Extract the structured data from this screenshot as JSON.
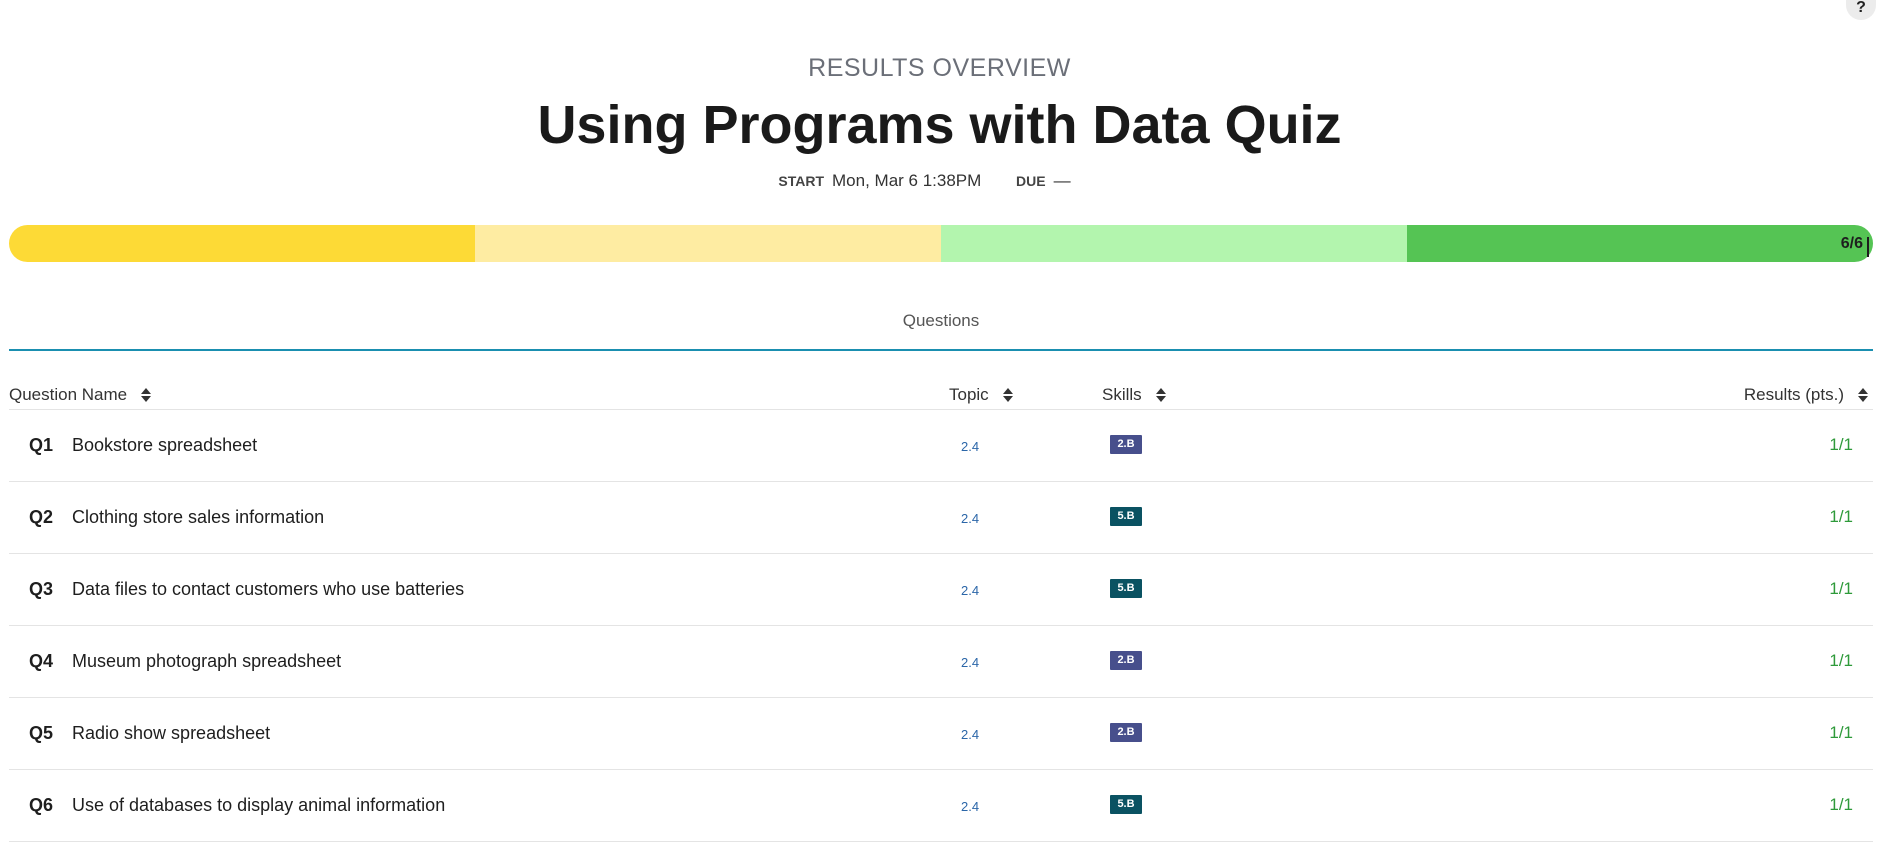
{
  "help": {
    "label": "?"
  },
  "header": {
    "overline": "RESULTS OVERVIEW",
    "title": "Using Programs with Data Quiz",
    "start_label": "START",
    "start_value": "Mon, Mar 6 1:38PM",
    "due_label": "DUE",
    "due_value": "—"
  },
  "progress": {
    "label": "6/6",
    "segments": [
      {
        "color": "#fdda36"
      },
      {
        "color": "#feeca2"
      },
      {
        "color": "#b3f5ae"
      },
      {
        "color": "#55c454"
      }
    ]
  },
  "tabs": [
    {
      "label": "Questions"
    }
  ],
  "table": {
    "columns": {
      "name": "Question Name",
      "topic": "Topic",
      "skills": "Skills",
      "results": "Results (pts.)"
    },
    "skill_colors": {
      "2.B": "#474f8c",
      "5.B": "#0a5262"
    },
    "rows": [
      {
        "num": "Q1",
        "name": "Bookstore spreadsheet",
        "topic": "2.4",
        "skill": "2.B",
        "score": "1/1"
      },
      {
        "num": "Q2",
        "name": "Clothing store sales information",
        "topic": "2.4",
        "skill": "5.B",
        "score": "1/1"
      },
      {
        "num": "Q3",
        "name": "Data files to contact customers who use batteries",
        "topic": "2.4",
        "skill": "5.B",
        "score": "1/1"
      },
      {
        "num": "Q4",
        "name": "Museum photograph spreadsheet",
        "topic": "2.4",
        "skill": "2.B",
        "score": "1/1"
      },
      {
        "num": "Q5",
        "name": "Radio show spreadsheet",
        "topic": "2.4",
        "skill": "2.B",
        "score": "1/1"
      },
      {
        "num": "Q6",
        "name": "Use of databases to display animal information",
        "topic": "2.4",
        "skill": "5.B",
        "score": "1/1"
      }
    ]
  }
}
